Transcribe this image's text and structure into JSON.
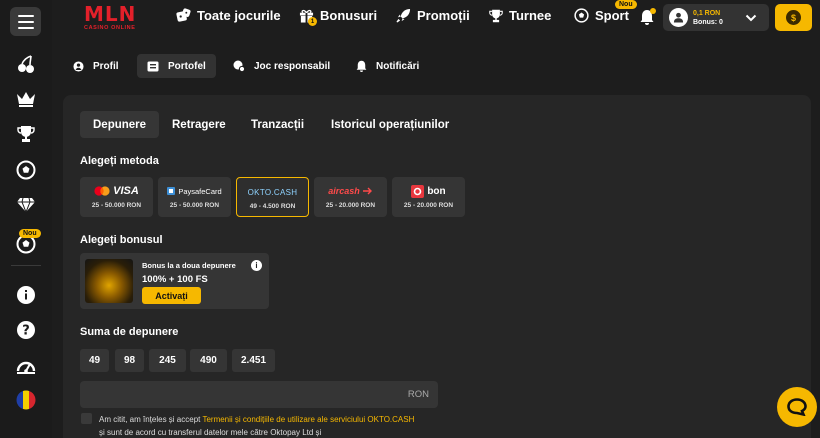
{
  "brand": {
    "name": "MLN",
    "tagline": "CASINO ONLINE"
  },
  "topnav": {
    "items": [
      {
        "label": "Toate jocurile",
        "icon": "dice-icon"
      },
      {
        "label": "Bonusuri",
        "icon": "gift-icon"
      },
      {
        "label": "Promoții",
        "icon": "rocket-icon"
      },
      {
        "label": "Turnee",
        "icon": "trophy-icon"
      },
      {
        "label": "Sport",
        "icon": "soccer-ball-icon",
        "badge": "Nou"
      }
    ],
    "bonus_gift_count": "1"
  },
  "account": {
    "balance": "0,1 RON",
    "bonus": "Bonus: 0",
    "cashier_symbol": "$"
  },
  "sidebar": {
    "badge": "Nou"
  },
  "profile_tabs": [
    {
      "label": "Profil",
      "icon": "user-icon"
    },
    {
      "label": "Portofel",
      "icon": "wallet-icon",
      "active": true
    },
    {
      "label": "Joc responsabil",
      "icon": "responsible-gaming-icon"
    },
    {
      "label": "Notificări",
      "icon": "bell-icon"
    }
  ],
  "wallet_tabs": [
    "Depunere",
    "Retragere",
    "Tranzacții",
    "Istoricul operațiunilor"
  ],
  "method_section": {
    "title": "Alegeți metoda"
  },
  "methods": [
    {
      "name": "VISA",
      "range": "25 - 50.000 RON"
    },
    {
      "name": "PaysafeCard",
      "range": "25 - 50.000 RON"
    },
    {
      "name": "OKTO.CASH",
      "range": "49 - 4.500 RON",
      "selected": true
    },
    {
      "name": "aircash",
      "range": "25 - 20.000 RON"
    },
    {
      "name": "bon",
      "range": "25 - 20.000 RON"
    }
  ],
  "bonus_section": {
    "title": "Alegeți bonusul",
    "bonus_name": "Bonus la a doua depunere",
    "bonus_value": "100% + 100 FS",
    "activate_label": "Activați",
    "info": "i"
  },
  "amount_section": {
    "title": "Suma de depunere",
    "presets": [
      "49",
      "98",
      "245",
      "490",
      "2.451"
    ],
    "currency": "RON",
    "value": ""
  },
  "terms": {
    "prefix": "Am citit, am înțeles și accept ",
    "link1": "Termenii și condițiile de utilizare ale serviciului OKTO.CASH",
    "suffix": " și sunt de acord cu transferul datelor mele către Oktopay Ltd și"
  },
  "colors": {
    "accent": "#f6b800",
    "brand": "#e3202a",
    "background": "#1d1d1d",
    "panel": "#262626"
  }
}
